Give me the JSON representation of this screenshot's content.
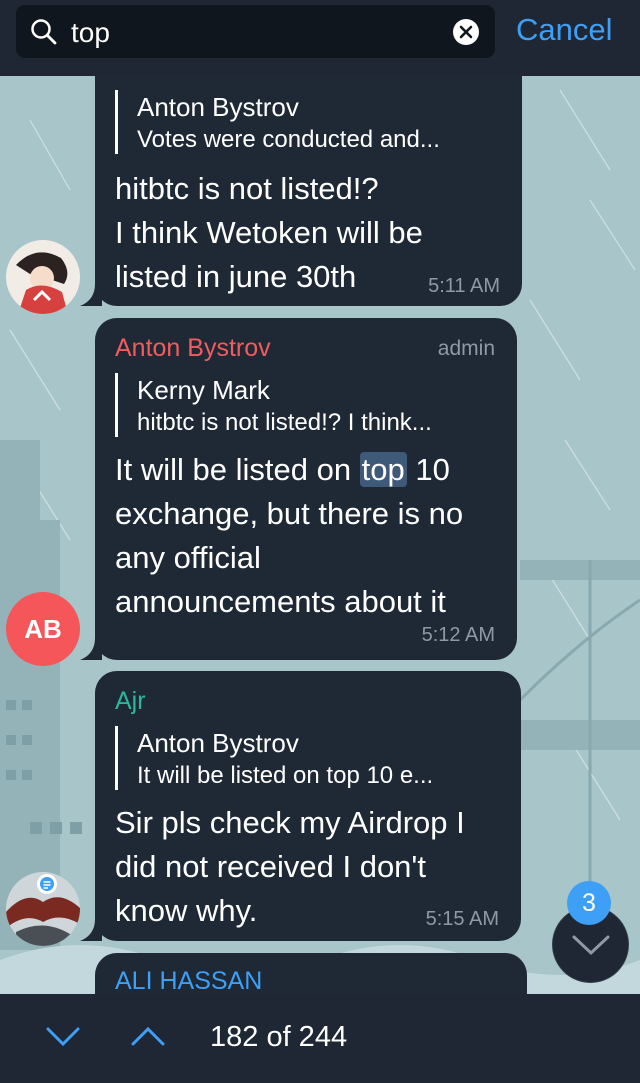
{
  "search": {
    "query": "top",
    "cancel_label": "Cancel"
  },
  "messages": [
    {
      "reply_to": {
        "name": "Anton Bystrov",
        "text": "Votes were conducted and..."
      },
      "lines": [
        "hitbtc is not listed!?",
        "I think Wetoken will be",
        "listed in june 30th"
      ],
      "time": "5:11 AM"
    },
    {
      "sender": "Anton Bystrov",
      "sender_color": "#f15c5c",
      "role": "admin",
      "avatar_initials": "AB",
      "reply_to": {
        "name": "Kerny Mark",
        "text": "hitbtc is not listed!? I think..."
      },
      "line1_before": "It will be listed on ",
      "line1_match": "top",
      "line1_after": " 10",
      "lines": [
        "exchange, but there is no",
        "any official",
        "announcements about it"
      ],
      "time": "5:12 AM"
    },
    {
      "sender": "Ajr",
      "sender_color": "#2ab89a",
      "reply_to": {
        "name": "Anton Bystrov",
        "text": "It will be listed on top 10 e..."
      },
      "lines": [
        "Sir pls check my Airdrop I",
        "did not received I don't",
        "know why."
      ],
      "time": "5:15 AM"
    },
    {
      "sender": "ALI HASSAN",
      "sender_color": "#3d9ff5"
    }
  ],
  "scroll_badge": "3",
  "results": {
    "counter": "182 of 244"
  },
  "colors": {
    "accent": "#3d9ff5",
    "bubble": "#1f2936",
    "bar": "#1e2733",
    "highlight": "#3e5a78"
  }
}
